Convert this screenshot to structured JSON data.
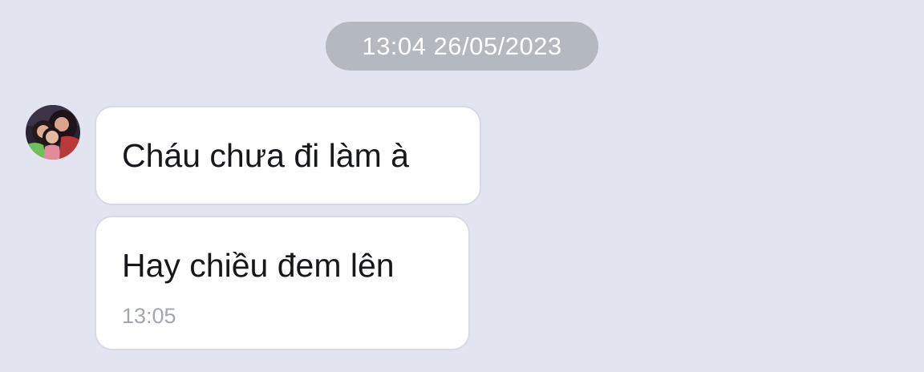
{
  "chat": {
    "date_separator": "13:04 26/05/2023",
    "messages": [
      {
        "sender_avatar": "contact-avatar-photo",
        "text": "Cháu chưa đi làm à",
        "time": ""
      },
      {
        "text": "Hay chiều đem lên",
        "time": "13:05"
      }
    ]
  },
  "colors": {
    "background": "#e2e5ef",
    "date_pill": "#b4b8bf",
    "bubble": "#ffffff",
    "bubble_border": "#d6dae3",
    "message_text": "#16181c",
    "time_text": "#a3a7ad"
  }
}
